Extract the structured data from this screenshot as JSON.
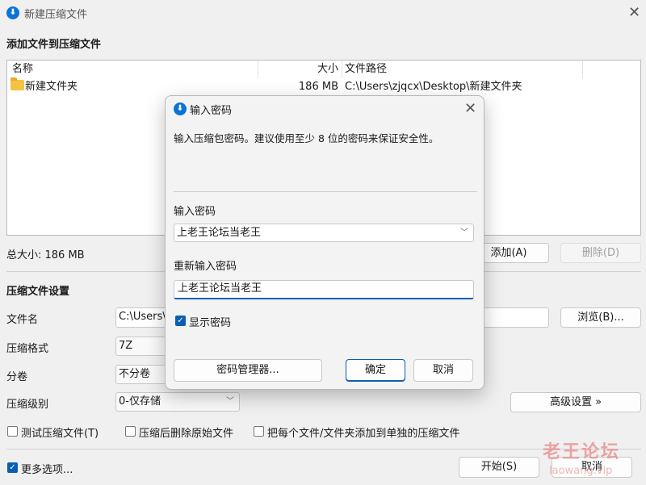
{
  "window": {
    "title": "新建压缩文件",
    "close_glyph": "✕"
  },
  "files_section": {
    "title": "添加文件到压缩文件",
    "columns": {
      "name": "名称",
      "size": "大小",
      "path": "文件路径"
    },
    "rows": [
      {
        "name": "新建文件夹",
        "size": "186 MB",
        "path": "C:\\Users\\zjqcx\\Desktop\\新建文件夹"
      }
    ],
    "total": "总大小: 186 MB",
    "add_button": "添加(A)",
    "delete_button": "删除(D)"
  },
  "settings": {
    "title": "压缩文件设置",
    "filename_label": "文件名",
    "filename_value": "C:\\Users\\",
    "browse_button": "浏览(B)...",
    "format_label": "压缩格式",
    "format_value": "7Z",
    "split_label": "分卷",
    "split_value": "不分卷",
    "level_label": "压缩级别",
    "level_value": "0-仅存储",
    "advanced_button": "高级设置 »",
    "test_checkbox": "测试压缩文件(T)",
    "delete_after_checkbox": "压缩后删除原始文件",
    "separate_checkbox": "把每个文件/文件夹添加到单独的压缩文件"
  },
  "footer": {
    "more_options": "更多选项...",
    "start_button": "开始(S)",
    "cancel_button": "取消"
  },
  "dialog": {
    "title": "输入密码",
    "description": "输入压缩包密码。建议使用至少 8 位的密码来保证安全性。",
    "password_label": "输入密码",
    "password_value": "上老王论坛当老王",
    "confirm_label": "重新输入密码",
    "confirm_value": "上老王论坛当老王",
    "show_password": "显示密码",
    "manager_button": "密码管理器...",
    "ok_button": "确定",
    "cancel_button": "取消"
  },
  "watermark": {
    "text": "老王论坛",
    "url": "laowang.vip"
  },
  "colors": {
    "accent": "#0a5fb4",
    "folder": "#f4c242",
    "app_icon": "#0a74d6"
  },
  "icons": {
    "app": "app-logo-icon",
    "folder": "folder-icon",
    "chevron": "chevron-down-icon",
    "close": "close-icon",
    "check": "check-icon"
  }
}
